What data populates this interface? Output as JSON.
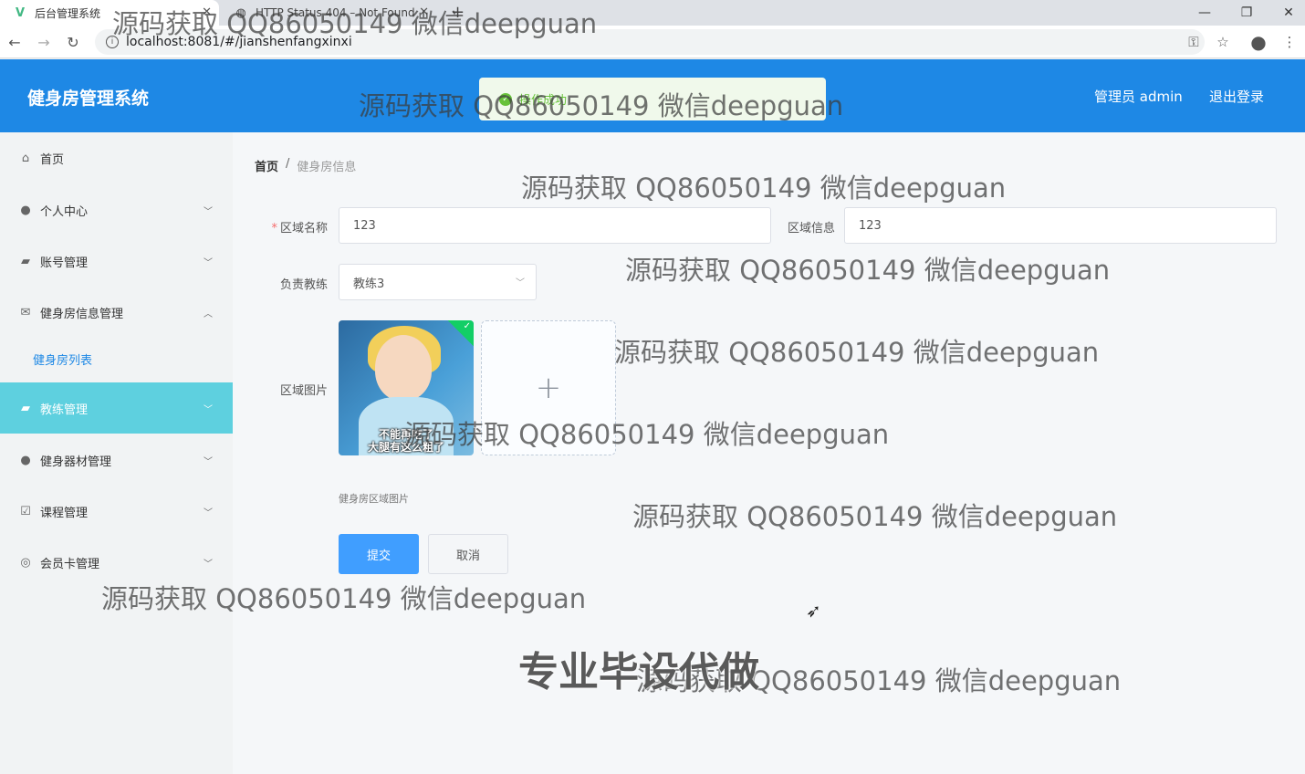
{
  "browser": {
    "tabs": [
      {
        "title": "后台管理系统",
        "favicon": "vue-icon"
      },
      {
        "title": "HTTP Status 404 – Not Found",
        "favicon": "globe-icon"
      }
    ],
    "url": "localhost:8081/#/jianshenfangxinxi",
    "window_controls": [
      "minimize-icon",
      "restore-icon",
      "close-icon"
    ]
  },
  "header": {
    "app_title": "健身房管理系统",
    "user_label": "管理员 admin",
    "logout_label": "退出登录",
    "toast_message": "操作成功",
    "bg_color": "#1e88e5"
  },
  "sidebar": {
    "items": [
      {
        "label": "首页",
        "icon": "home-icon"
      },
      {
        "label": "个人中心",
        "icon": "user-icon"
      },
      {
        "label": "账号管理",
        "icon": "wallet-icon"
      },
      {
        "label": "健身房信息管理",
        "icon": "mail-icon"
      },
      {
        "label": "健身房列表",
        "submenu": true
      },
      {
        "label": "教练管理",
        "icon": "briefcase-icon",
        "active": true
      },
      {
        "label": "健身器材管理",
        "icon": "user-icon"
      },
      {
        "label": "课程管理",
        "icon": "checkbox-icon"
      },
      {
        "label": "会员卡管理",
        "icon": "compass-icon"
      }
    ],
    "active_color": "#5ed0df"
  },
  "breadcrumb": {
    "home": "首页",
    "separator": "/",
    "current": "健身房信息"
  },
  "form": {
    "area_name_label": "区域名称",
    "area_name_value": "123",
    "area_info_label": "区域信息",
    "area_info_value": "123",
    "coach_label": "负责教练",
    "coach_value": "教练3",
    "image_label": "区域图片",
    "image_caption_line1": "不能再吃了",
    "image_caption_line2": "大腿有这么粗了",
    "image_tip": "健身房区域图片",
    "submit_label": "提交",
    "cancel_label": "取消"
  },
  "watermarks": {
    "text": "源码获取 QQ86050149 微信deepguan",
    "stamp": "专业毕设代做"
  }
}
